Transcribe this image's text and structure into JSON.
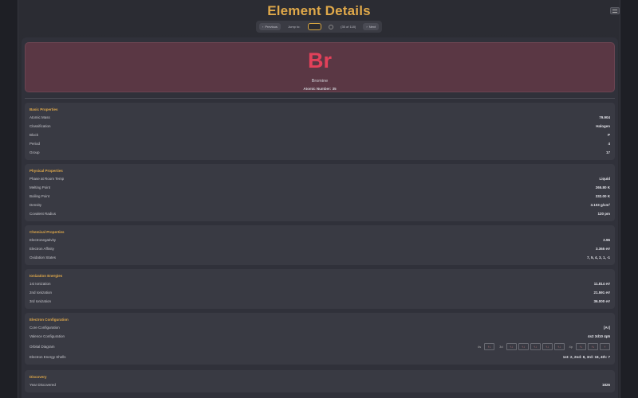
{
  "header": {
    "title": "Element Details"
  },
  "nav": {
    "previous_label": "Previous",
    "previous_icon": "chevron-left-icon",
    "jump_label": "Jump to:",
    "jump_value": "",
    "go_icon": "refresh-icon",
    "position_text": "(35 of 118)",
    "next_label": "Next",
    "next_icon": "chevron-right-icon"
  },
  "element": {
    "symbol": "Br",
    "name": "Bromine",
    "atomic_number_text": "Atomic Number: 35",
    "symbol_color": "#e2415a",
    "card_color": "#5a3744"
  },
  "sections": {
    "basic": {
      "title": "Basic Properties",
      "rows": [
        {
          "label": "Atomic Mass",
          "value": "79.904"
        },
        {
          "label": "Classification",
          "value": "Halogen"
        },
        {
          "label": "Block",
          "value": "P"
        },
        {
          "label": "Period",
          "value": "4"
        },
        {
          "label": "Group",
          "value": "17"
        }
      ]
    },
    "physical": {
      "title": "Physical Properties",
      "rows": [
        {
          "label": "Phase at Room Temp",
          "value": "Liquid"
        },
        {
          "label": "Melting Point",
          "value": "265.80 K"
        },
        {
          "label": "Boiling Point",
          "value": "332.00 K"
        },
        {
          "label": "Density",
          "value": "3.103 g/cm³"
        },
        {
          "label": "Covalent Radius",
          "value": "120 pm"
        }
      ]
    },
    "chemical": {
      "title": "Chemical Properties",
      "rows": [
        {
          "label": "Electronegativity",
          "value": "2.96"
        },
        {
          "label": "Electron Affinity",
          "value": "3.365 eV"
        },
        {
          "label": "Oxidation States",
          "value": "7, 5, 4, 3, 1, -1"
        }
      ]
    },
    "ionization": {
      "title": "Ionization Energies",
      "rows": [
        {
          "label": "1st Ionization",
          "value": "11.814 eV"
        },
        {
          "label": "2nd Ionization",
          "value": "21.591 eV"
        },
        {
          "label": "3rd Ionization",
          "value": "36.000 eV"
        }
      ]
    },
    "electron": {
      "title": "Electron Configuration",
      "core_label": "Core Configuration",
      "core_value": "[Ar]",
      "valence_label": "Valence Configuration",
      "valence_value": "4s2 3d10 4p5",
      "orbital_label": "Orbital Diagram",
      "orbitals": [
        {
          "label": "4s",
          "boxes": [
            "↑↓"
          ]
        },
        {
          "label": "3d",
          "boxes": [
            "↑↓",
            "↑↓",
            "↑↓",
            "↑↓",
            "↑↓"
          ]
        },
        {
          "label": "4p",
          "boxes": [
            "↑↓",
            "↑↓",
            "↑"
          ]
        }
      ],
      "shells_label": "Electron Energy Shells",
      "shells_value": "1st: 2, 2nd: 8, 3rd: 18, 4th: 7"
    },
    "discovery": {
      "title": "Discovery",
      "rows": [
        {
          "label": "Year Discovered",
          "value": "1826"
        }
      ]
    }
  }
}
